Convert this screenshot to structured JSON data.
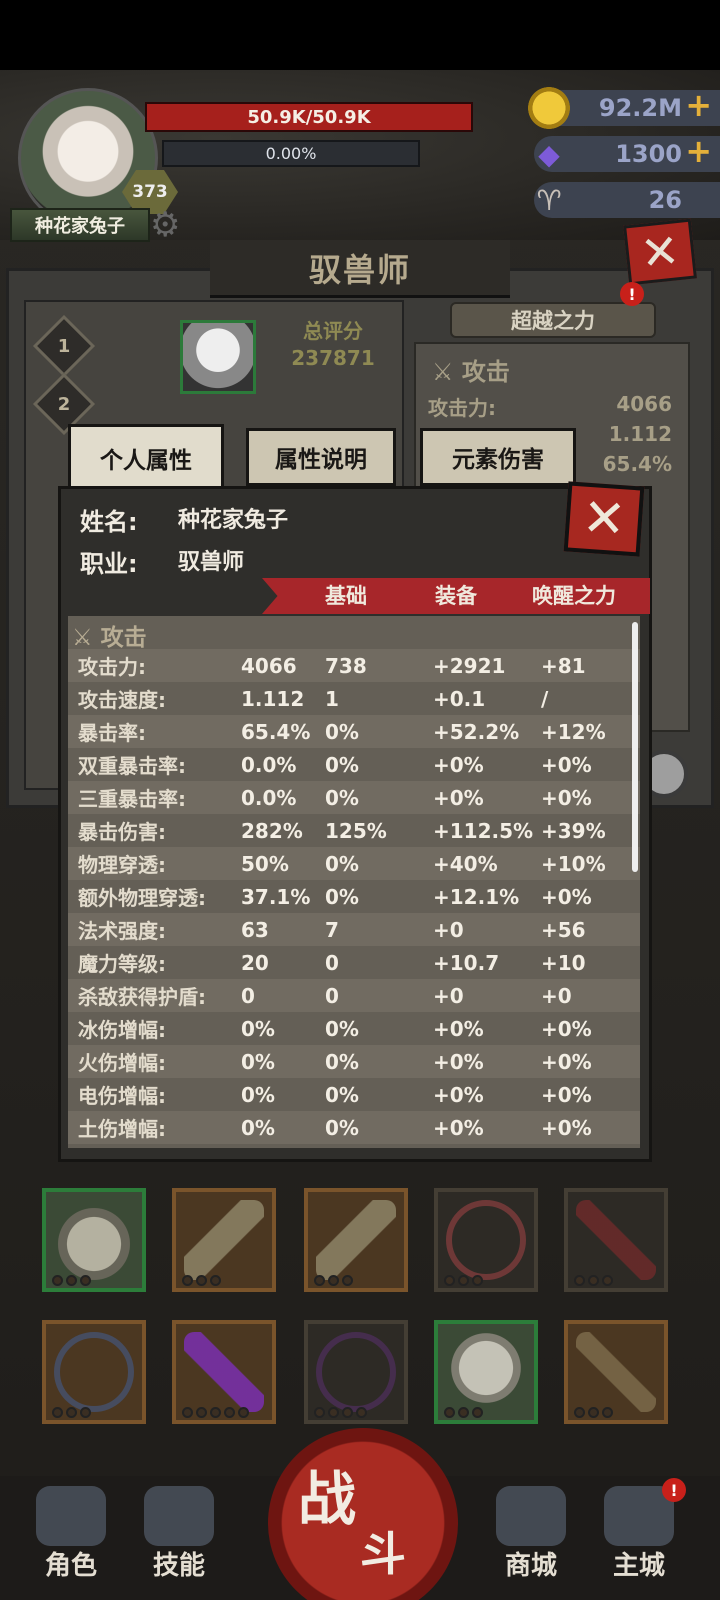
{
  "player": {
    "name": "种花家兔子",
    "level": "373",
    "hp": "50.9K/50.9K",
    "xp_percent": "0.00%"
  },
  "resources": {
    "gold": "92.2M",
    "gems": "1300",
    "horns": "26",
    "plus": "+"
  },
  "header": {
    "title": "驭兽师",
    "close": "✕"
  },
  "back_panel": {
    "score_label": "总评分",
    "score_value": "237871",
    "slots": [
      "1",
      "2"
    ],
    "transcend_label": "超越之力",
    "badge": "!",
    "side_title": "攻击",
    "side_rows": [
      {
        "label": "攻击力:",
        "value": "4066"
      },
      {
        "label": "",
        "value": "1.112"
      },
      {
        "label": "",
        "value": "65.4%"
      }
    ]
  },
  "tabs": [
    "个人属性",
    "属性说明",
    "元素伤害"
  ],
  "dialog": {
    "name_label": "姓名:",
    "name_value": "种花家兔子",
    "job_label": "职业:",
    "job_value": "驭兽师",
    "columns": [
      "基础",
      "装备",
      "唤醒之力"
    ],
    "section_title": "攻击",
    "close": "✕",
    "rows": [
      [
        "攻击力:",
        "4066",
        "738",
        "+2921",
        "+81"
      ],
      [
        "攻击速度:",
        "1.112",
        "1",
        "+0.1",
        "/"
      ],
      [
        "暴击率:",
        "65.4%",
        "0%",
        "+52.2%",
        "+12%"
      ],
      [
        "双重暴击率:",
        "0.0%",
        "0%",
        "+0%",
        "+0%"
      ],
      [
        "三重暴击率:",
        "0.0%",
        "0%",
        "+0%",
        "+0%"
      ],
      [
        "暴击伤害:",
        "282%",
        "125%",
        "+112.5%",
        "+39%"
      ],
      [
        "物理穿透:",
        "50%",
        "0%",
        "+40%",
        "+10%"
      ],
      [
        "额外物理穿透:",
        "37.1%",
        "0%",
        "+12.1%",
        "+0%"
      ],
      [
        "法术强度:",
        "63",
        "7",
        "+0",
        "+56"
      ],
      [
        "魔力等级:",
        "20",
        "0",
        "+10.7",
        "+10"
      ],
      [
        "杀敌获得护盾:",
        "0",
        "0",
        "+0",
        "+0"
      ],
      [
        "冰伤增幅:",
        "0%",
        "0%",
        "+0%",
        "+0%"
      ],
      [
        "火伤增幅:",
        "0%",
        "0%",
        "+0%",
        "+0%"
      ],
      [
        "电伤增幅:",
        "0%",
        "0%",
        "+0%",
        "+0%"
      ],
      [
        "土伤增幅:",
        "0%",
        "0%",
        "+0%",
        "+0%"
      ]
    ]
  },
  "nav": {
    "role": "角色",
    "skill": "技能",
    "battle_1": "战",
    "battle_2": "斗",
    "shop": "商城",
    "city": "主城",
    "badge": "!"
  },
  "colors": {
    "accent_red": "#a7262a",
    "gold": "#e4b03a",
    "score_text": "#8f8a53"
  }
}
